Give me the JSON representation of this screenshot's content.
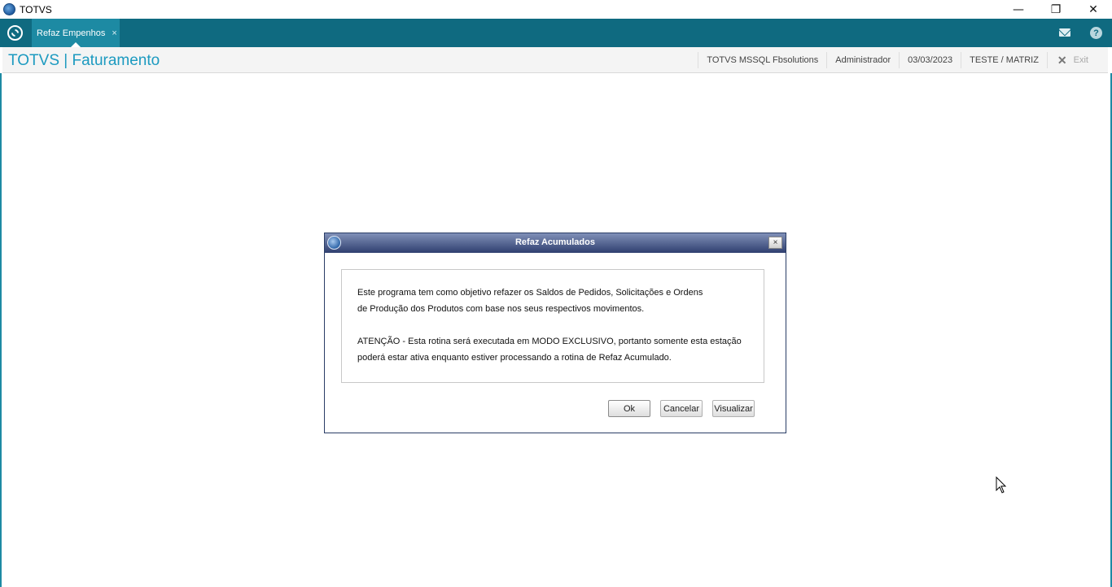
{
  "window": {
    "title": "TOTVS",
    "minimize": "—",
    "restore": "❐",
    "close": "✕"
  },
  "appbar": {
    "tab_label": "Refaz Empenhos",
    "tab_close": "×",
    "help": "?"
  },
  "header": {
    "title": "TOTVS | Faturamento",
    "environment": "TOTVS  MSSQL Fbsolutions",
    "user": "Administrador",
    "date": "03/03/2023",
    "branch": "TESTE / MATRIZ",
    "exit_icon": "✕",
    "exit_label": "Exit"
  },
  "dialog": {
    "title": "Refaz Acumulados",
    "close": "×",
    "lines": [
      "Este programa tem como objetivo refazer os Saldos de Pedidos, Solicitações e Ordens",
      "de Produção dos Produtos com base nos seus respectivos movimentos.",
      "ATENÇÃO - Esta rotina será executada em MODO EXCLUSIVO, portanto somente esta estação",
      "poderá estar ativa enquanto estiver processando a rotina de Refaz Acumulado."
    ],
    "buttons": {
      "ok": "Ok",
      "cancel": "Cancelar",
      "view": "Visualizar"
    }
  },
  "colors": {
    "appbar": "#0f6a80",
    "tab_active": "#1d8aa3",
    "title_accent": "#1c9ac0",
    "dialog_title": "#2f3f6f"
  }
}
